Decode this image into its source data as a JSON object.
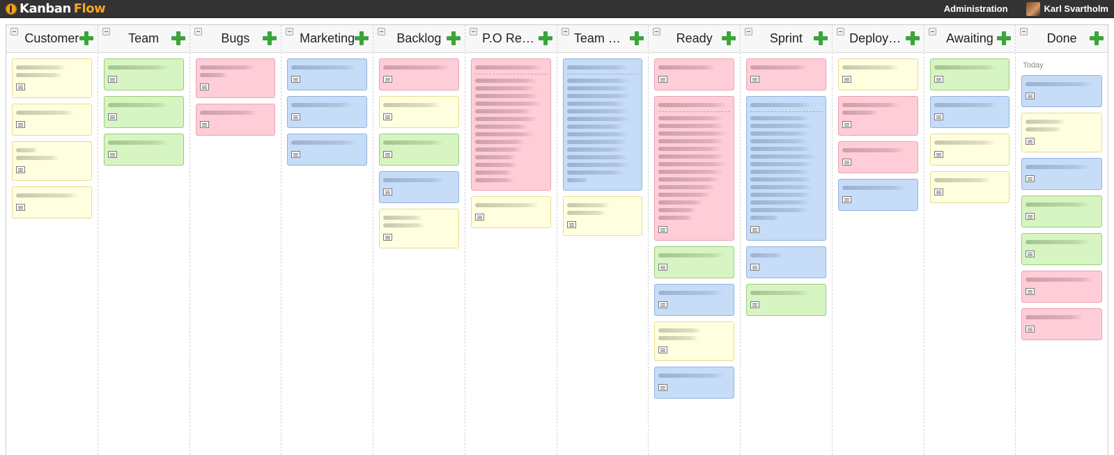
{
  "app": {
    "logo_kanban": "Kanban",
    "logo_flow": "Flow"
  },
  "header": {
    "admin_label": "Administration",
    "user_name": "Karl Svartholm"
  },
  "columns": [
    {
      "title": "Customer",
      "cards": [
        {
          "color": "yellow",
          "lines": [
            70,
            65
          ],
          "note": true
        },
        {
          "color": "yellow",
          "lines": [
            82
          ],
          "note": true
        },
        {
          "color": "yellow",
          "lines": [
            30,
            60
          ],
          "note": true
        },
        {
          "color": "yellow",
          "lines": [
            88
          ],
          "note": true
        }
      ]
    },
    {
      "title": "Team",
      "cards": [
        {
          "color": "green",
          "lines": [
            85
          ],
          "note": true
        },
        {
          "color": "green",
          "lines": [
            85
          ],
          "note": true
        },
        {
          "color": "green",
          "lines": [
            85
          ],
          "note": true
        }
      ]
    },
    {
      "title": "Bugs",
      "cards": [
        {
          "color": "red",
          "lines": [
            78,
            38
          ],
          "note": true
        },
        {
          "color": "red",
          "lines": [
            80
          ],
          "note": true
        }
      ]
    },
    {
      "title": "Marketing",
      "cards": [
        {
          "color": "blue",
          "lines": [
            90
          ],
          "note": true
        },
        {
          "color": "blue",
          "lines": [
            85
          ],
          "note": true
        },
        {
          "color": "blue",
          "lines": [
            90
          ],
          "note": true
        }
      ]
    },
    {
      "title": "Backlog",
      "cards": [
        {
          "color": "red",
          "lines": [
            92
          ],
          "note": true
        },
        {
          "color": "yellow",
          "lines": [
            80
          ],
          "note": true
        },
        {
          "color": "green",
          "lines": [
            84
          ],
          "note": true
        },
        {
          "color": "blue",
          "lines": [
            86
          ],
          "note": true
        },
        {
          "color": "yellow",
          "lines": [
            55,
            58
          ],
          "note": true
        }
      ]
    },
    {
      "title": "P.O Review",
      "cards": [
        {
          "color": "red",
          "lines": [
            96,
            88,
            85,
            90,
            94,
            80,
            88,
            75,
            82,
            70,
            66,
            58,
            60,
            52,
            55
          ],
          "sep_after": 0,
          "note": false
        },
        {
          "color": "yellow",
          "lines": [
            90
          ],
          "note": true
        }
      ]
    },
    {
      "title": "Team Work",
      "cards": [
        {
          "color": "blue",
          "lines": [
            86,
            88,
            86,
            90,
            82,
            86,
            88,
            80,
            86,
            84,
            80,
            86,
            88,
            80,
            30
          ],
          "sep_after": 0,
          "note": false
        },
        {
          "color": "yellow",
          "lines": [
            60,
            55
          ],
          "note": true
        }
      ]
    },
    {
      "title": "Ready",
      "cards": [
        {
          "color": "red",
          "lines": [
            80
          ],
          "note": true
        },
        {
          "color": "red",
          "lines": [
            96,
            90,
            92,
            96,
            92,
            88,
            92,
            96,
            90,
            86,
            80,
            74,
            62,
            52,
            48
          ],
          "sep_after": 0,
          "note": true
        },
        {
          "color": "green",
          "lines": [
            92
          ],
          "note": true
        },
        {
          "color": "blue",
          "lines": [
            90
          ],
          "note": true
        },
        {
          "color": "yellow",
          "lines": [
            60,
            55
          ],
          "note": true
        },
        {
          "color": "blue",
          "lines": [
            92
          ],
          "note": true
        }
      ]
    },
    {
      "title": "Sprint",
      "cards": [
        {
          "color": "red",
          "lines": [
            80
          ],
          "note": true
        },
        {
          "color": "blue",
          "lines": [
            86,
            84,
            88,
            82,
            80,
            86,
            92,
            88,
            84,
            86,
            88,
            86,
            84,
            82,
            40
          ],
          "sep_after": 0,
          "note": true
        },
        {
          "color": "blue",
          "lines": [
            45
          ],
          "note": true
        },
        {
          "color": "green",
          "lines": [
            82
          ],
          "note": true
        }
      ]
    },
    {
      "title": "Deployment",
      "cards": [
        {
          "color": "yellow",
          "lines": [
            80
          ],
          "note": true
        },
        {
          "color": "red",
          "lines": [
            80,
            50
          ],
          "note": true
        },
        {
          "color": "red",
          "lines": [
            88
          ],
          "note": true
        },
        {
          "color": "blue",
          "lines": [
            90
          ],
          "note": true
        }
      ]
    },
    {
      "title": "Awaiting",
      "cards": [
        {
          "color": "green",
          "lines": [
            88
          ],
          "note": true
        },
        {
          "color": "blue",
          "lines": [
            90
          ],
          "note": true
        },
        {
          "color": "yellow",
          "lines": [
            86
          ],
          "note": true
        },
        {
          "color": "yellow",
          "lines": [
            80
          ],
          "note": true
        }
      ]
    },
    {
      "title": "Done",
      "date_label": "Today",
      "cards": [
        {
          "color": "blue",
          "lines": [
            92
          ],
          "note": true
        },
        {
          "color": "yellow",
          "lines": [
            55,
            50
          ],
          "note": true
        },
        {
          "color": "blue",
          "lines": [
            88
          ],
          "note": true
        },
        {
          "color": "green",
          "lines": [
            88
          ],
          "note": true
        },
        {
          "color": "green",
          "lines": [
            88
          ],
          "note": true
        },
        {
          "color": "red",
          "lines": [
            94
          ],
          "note": true
        },
        {
          "color": "red",
          "lines": [
            80
          ],
          "note": true
        }
      ]
    }
  ]
}
